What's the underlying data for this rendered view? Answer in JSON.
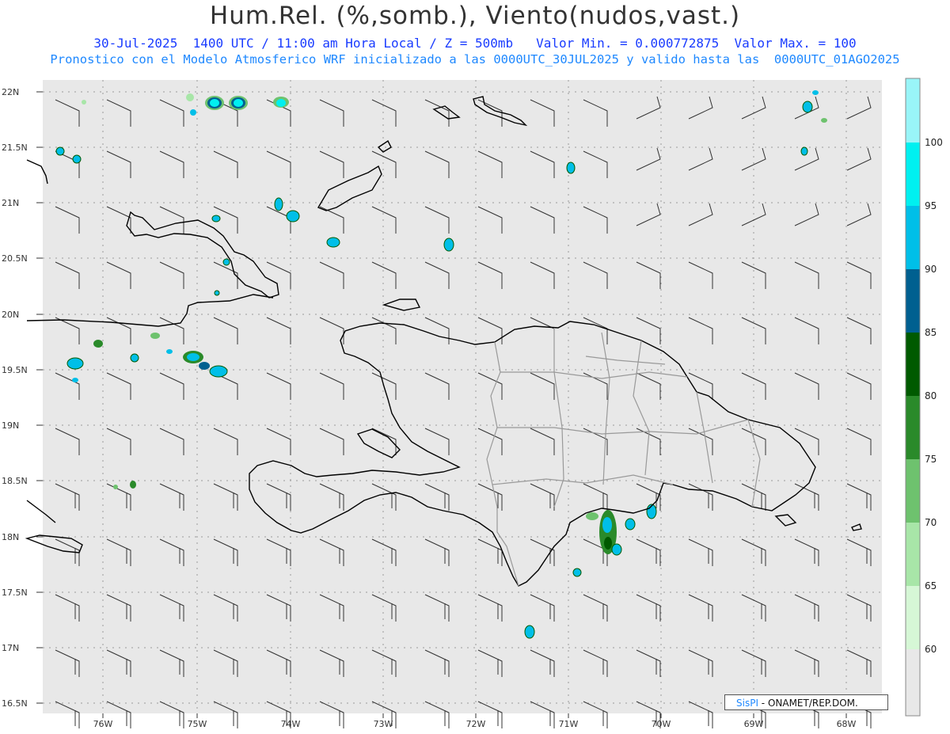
{
  "title": "Hum.Rel. (%,somb.), Viento(nudos,vast.)",
  "subtitle_line1": "30-Jul-2025  1400 UTC / 11:00 am Hora Local / Z = 500mb   Valor Min. = 0.000772875  Valor Max. = 100",
  "subtitle_line2": "Pronostico con el Modelo Atmosferico WRF inicializado a las 0000UTC_30JUL2025 y valido hasta las  0000UTC_01AGO2025",
  "credit": {
    "brand": "SisPI",
    "text": " - ONAMET/REP.DOM."
  },
  "map": {
    "lat_labels": [
      "22N",
      "21.5N",
      "21N",
      "20.5N",
      "20N",
      "19.5N",
      "19N",
      "18.5N",
      "18N",
      "17.5N",
      "17N",
      "16.5N"
    ],
    "lon_labels": [
      "76W",
      "75W",
      "74W",
      "73W",
      "72W",
      "71W",
      "70W",
      "69W",
      "68W"
    ],
    "colorbar": {
      "labels": [
        "100",
        "95",
        "90",
        "85",
        "80",
        "75",
        "70",
        "65",
        "60"
      ],
      "colors": [
        "#99f5f8",
        "#00f0f0",
        "#00bfe8",
        "#006090",
        "#005a00",
        "#2a8a2a",
        "#6ec26e",
        "#a8e6a8",
        "#d6f7d6",
        "#e8e8e8"
      ]
    }
  }
}
